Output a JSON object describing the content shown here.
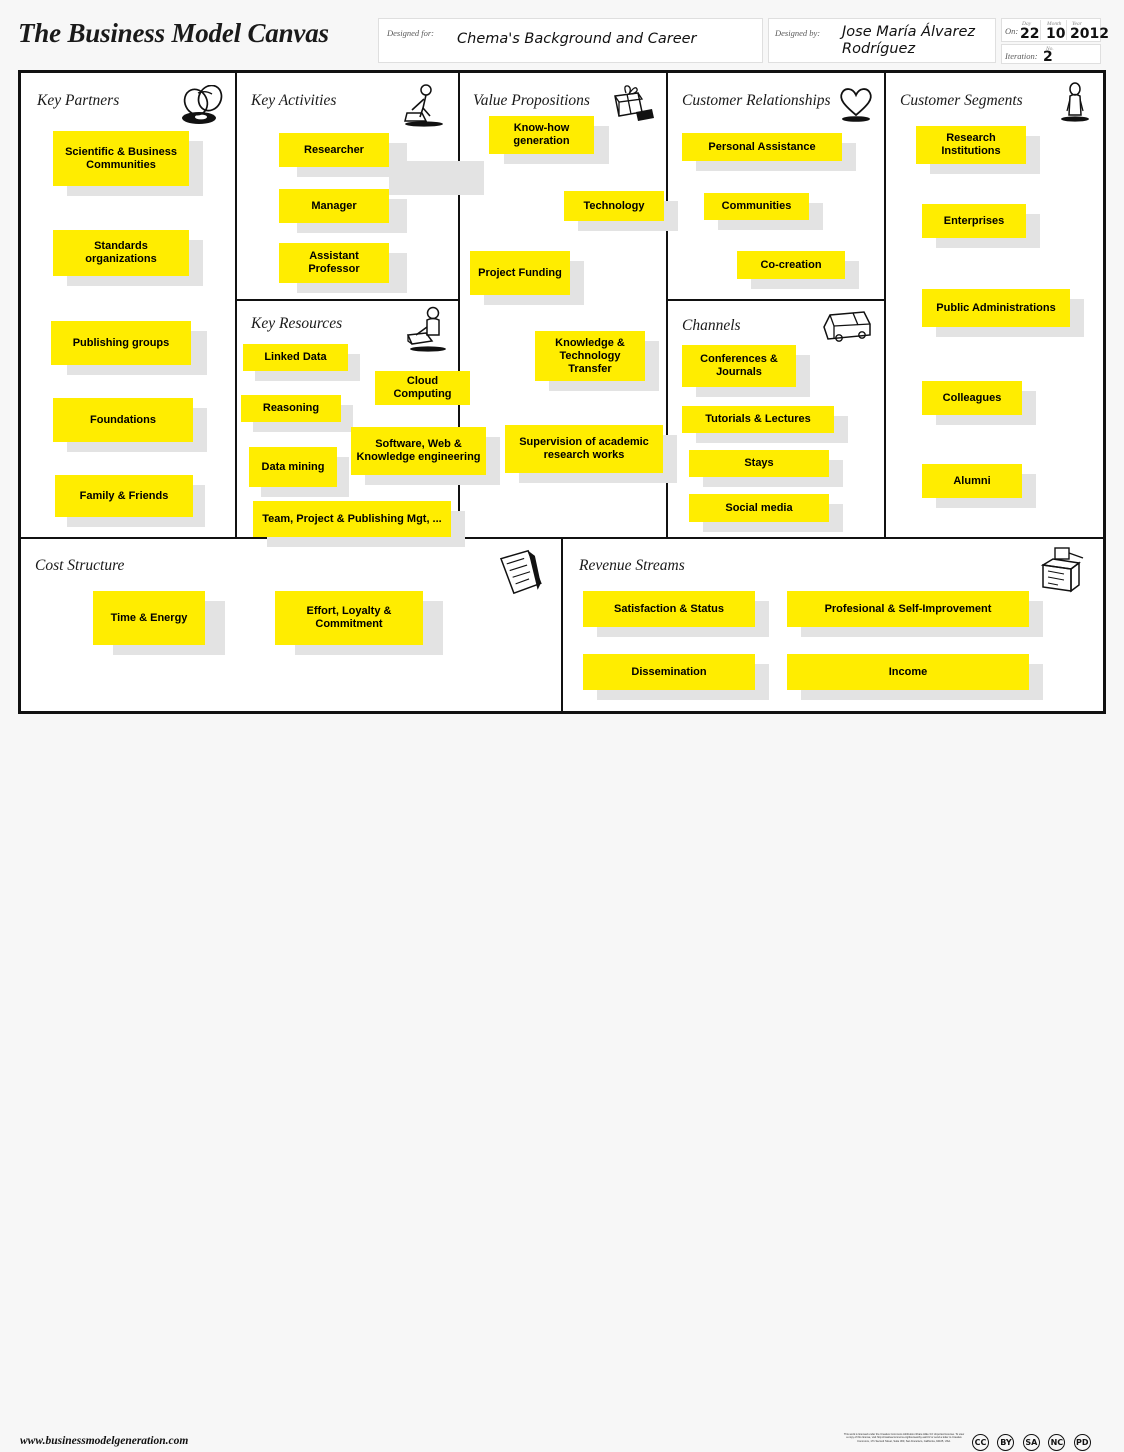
{
  "header": {
    "title": "The Business Model Canvas",
    "designed_for_label": "Designed for:",
    "designed_for_value": "Chema's Background and Career",
    "designed_by_label": "Designed by:",
    "designed_by_value": "Jose María Álvarez Rodríguez",
    "on_label": "On:",
    "day_label": "Day",
    "month_label": "Month",
    "year_label": "Year",
    "day_value": "22",
    "month_value": "10",
    "year_value": "2012",
    "iteration_label": "Iteration:",
    "iteration_no_label": "No.",
    "iteration_value": "2"
  },
  "blocks": {
    "key_partners": {
      "title": "Key Partners",
      "icon": "chain-links-icon",
      "notes": [
        "Scientific & Business Communities",
        "Standards organizations",
        "Publishing groups",
        "Foundations",
        "Family & Friends"
      ]
    },
    "key_activities": {
      "title": "Key Activities",
      "icon": "worker-pushing-icon",
      "notes": [
        "Researcher",
        "Manager",
        "Assistant Professor"
      ]
    },
    "key_resources": {
      "title": "Key Resources",
      "icon": "person-with-crate-icon",
      "notes": [
        "Linked Data",
        "Reasoning",
        "Data mining",
        "Cloud Computing",
        "Software, Web & Knowledge engineering",
        "Team, Project & Publishing Mgt, ..."
      ]
    },
    "value_propositions": {
      "title": "Value Propositions",
      "icon": "gift-box-icon",
      "notes": [
        "Know-how generation",
        "Technology",
        "Project Funding",
        "Knowledge & Technology Transfer",
        "Supervision of academic research works"
      ]
    },
    "customer_relationships": {
      "title": "Customer Relationships",
      "icon": "heart-icon",
      "notes": [
        "Personal Assistance",
        "Communities",
        "Co-creation"
      ]
    },
    "channels": {
      "title": "Channels",
      "icon": "delivery-truck-icon",
      "notes": [
        "Conferences & Journals",
        "Tutorials & Lectures",
        "Stays",
        "Social media"
      ]
    },
    "customer_segments": {
      "title": "Customer Segments",
      "icon": "standing-person-icon",
      "notes": [
        "Research Institutions",
        "Enterprises",
        "Public Administrations",
        "Colleagues",
        "Alumni"
      ]
    },
    "cost_structure": {
      "title": "Cost Structure",
      "icon": "invoice-icon",
      "notes": [
        "Time & Energy",
        "Effort, Loyalty & Commitment"
      ]
    },
    "revenue_streams": {
      "title": "Revenue Streams",
      "icon": "cash-register-icon",
      "notes": [
        "Satisfaction & Status",
        "Profesional & Self-Improvement",
        "Dissemination",
        "Income"
      ]
    }
  },
  "footer": {
    "url": "www.businessmodelgeneration.com",
    "license_text": "This work is licensed under the Creative Commons Attribution-Share Alike 3.0 Unported License. To view a copy of this license, visit http://creativecommons.org/licenses/by-sa/3.0/ or send a letter to Creative Commons, 171 Second Street, Suite 300, San Francisco, California, 94105, USA.",
    "cc_badges": [
      "CC",
      "BY",
      "SA",
      "NC",
      "PD"
    ]
  },
  "colors": {
    "sticky_yellow": "#ffed00",
    "sticky_shadow": "#e3e3e3",
    "frame_black": "#111111",
    "page_background": "#f7f7f7"
  }
}
